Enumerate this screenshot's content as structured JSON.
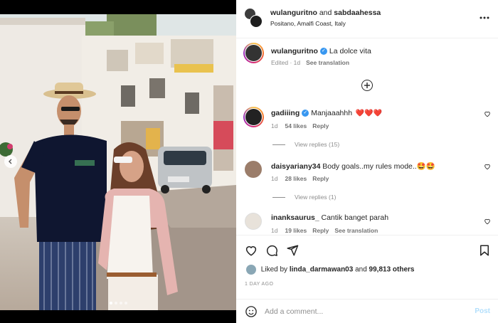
{
  "header": {
    "author": "wulanguritno",
    "joiner": "and",
    "coauthor": "sabdaahessa",
    "location": "Positano, Amalfi Coast, Italy",
    "more_icon": "more-horizontal-icon"
  },
  "caption": {
    "username": "wulanguritno",
    "verified": true,
    "text": "La dolce vita",
    "edited": "Edited · 1d",
    "see_translation": "See translation"
  },
  "comments": [
    {
      "username": "gadiiing",
      "verified": true,
      "text": "Manjaaahhh",
      "emoji": "❤️❤️❤️",
      "age": "1d",
      "likes": "54 likes",
      "reply": "Reply",
      "view_replies": "View replies (15)"
    },
    {
      "username": "daisyariany34",
      "verified": false,
      "text": "Body goals..my rules mode..",
      "emoji": "🤩🤩",
      "age": "1d",
      "likes": "28 likes",
      "reply": "Reply",
      "view_replies": "View replies (1)"
    },
    {
      "username": "inanksaurus_",
      "verified": false,
      "text": "Cantik banget parah",
      "age": "1d",
      "likes": "19 likes",
      "reply": "Reply",
      "see_translation": "See translation"
    }
  ],
  "engagement": {
    "liked_by_prefix": "Liked by",
    "liked_by_user": "linda_darmawan03",
    "and": "and",
    "others": "99,813 others",
    "time_ago": "1 DAY AGO"
  },
  "comment_box": {
    "placeholder": "Add a comment...",
    "post_label": "Post"
  },
  "colors": {
    "link_blue": "#3897f0",
    "post_disabled": "#b2dffc",
    "heart_red": "#ed4956",
    "muted": "#8e8e8e"
  }
}
